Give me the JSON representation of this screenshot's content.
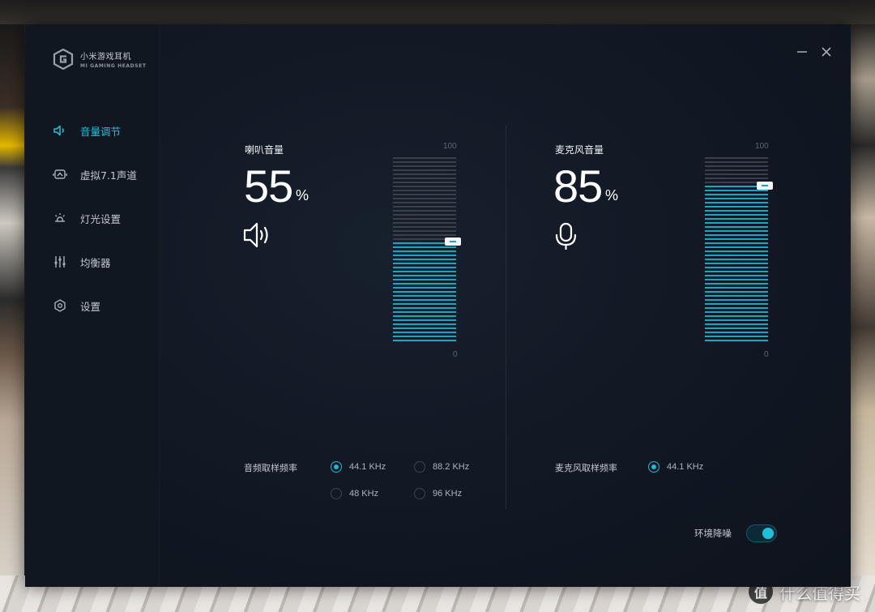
{
  "app": {
    "name": "小米游戏耳机",
    "subtitle": "MI GAMING HEADSET"
  },
  "sidebar": {
    "items": [
      {
        "label": "音量调节",
        "icon": "speaker-icon",
        "active": true
      },
      {
        "label": "虚拟7.1声道",
        "icon": "surround-icon",
        "active": false
      },
      {
        "label": "灯光设置",
        "icon": "light-icon",
        "active": false
      },
      {
        "label": "均衡器",
        "icon": "equalizer-icon",
        "active": false
      },
      {
        "label": "设置",
        "icon": "gear-icon",
        "active": false
      }
    ]
  },
  "speaker": {
    "title": "喇叭音量",
    "value": "55",
    "unit": "%",
    "level": 0.55,
    "meter_max": "100",
    "meter_min": "0",
    "rate_label": "音频取样频率",
    "rates": [
      {
        "label": "44.1 KHz",
        "checked": true
      },
      {
        "label": "88.2 KHz",
        "checked": false
      },
      {
        "label": "48 KHz",
        "checked": false
      },
      {
        "label": "96 KHz",
        "checked": false
      }
    ]
  },
  "mic": {
    "title": "麦克风音量",
    "value": "85",
    "unit": "%",
    "level": 0.85,
    "meter_max": "100",
    "meter_min": "0",
    "rate_label": "麦克风取样频率",
    "rates": [
      {
        "label": "44.1 KHz",
        "checked": true
      }
    ]
  },
  "noise_reduction": {
    "label": "环境降噪",
    "enabled": true
  },
  "colors": {
    "accent": "#1fb8d2",
    "meter_filled": "#1aa6c0",
    "meter_empty": "#3a3f48",
    "window_bg": "#121925",
    "sidebar_bg": "#111720"
  },
  "watermark": {
    "logo": "值",
    "text": "什么值得买"
  }
}
